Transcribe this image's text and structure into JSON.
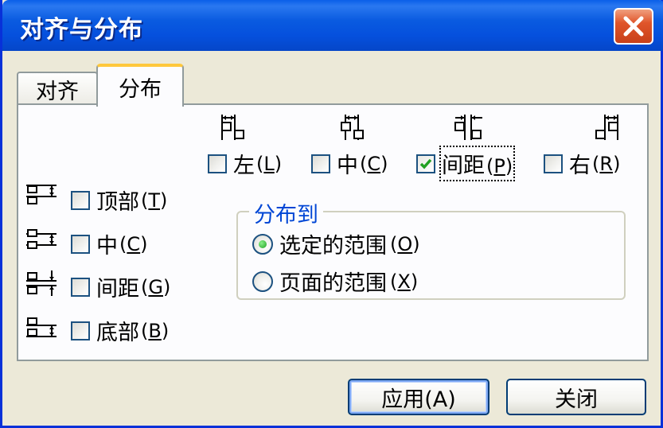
{
  "window": {
    "title": "对齐与分布"
  },
  "tabs": [
    {
      "label": "对齐",
      "active": false
    },
    {
      "label": "分布",
      "active": true
    }
  ],
  "horizontal": [
    {
      "label": "左",
      "key": "L",
      "checked": false,
      "icon": "distribute-left-icon"
    },
    {
      "label": "中",
      "key": "C",
      "checked": false,
      "icon": "distribute-center-horizontal-icon"
    },
    {
      "label": "间距",
      "key": "P",
      "checked": true,
      "icon": "distribute-horizontal-spacing-icon"
    },
    {
      "label": "右",
      "key": "R",
      "checked": false,
      "icon": "distribute-right-icon"
    }
  ],
  "vertical": [
    {
      "label": "顶部",
      "key": "T",
      "checked": false,
      "icon": "distribute-top-icon"
    },
    {
      "label": "中",
      "key": "C",
      "checked": false,
      "icon": "distribute-center-vertical-icon"
    },
    {
      "label": "间距",
      "key": "G",
      "checked": false,
      "icon": "distribute-vertical-spacing-icon"
    },
    {
      "label": "底部",
      "key": "B",
      "checked": false,
      "icon": "distribute-bottom-icon"
    }
  ],
  "distribute_to": {
    "title": "分布到",
    "options": [
      {
        "label": "选定的范围",
        "key": "O",
        "selected": true
      },
      {
        "label": "页面的范围",
        "key": "X",
        "selected": false
      }
    ]
  },
  "buttons": {
    "apply": "应用(A)",
    "close": "关闭"
  },
  "colors": {
    "titlebar": "#0550DD",
    "face": "#ECE9D8",
    "panel": "#FCFCFE",
    "accent_tab": "#FFC83C",
    "group_title": "#0046D5",
    "checkmark": "#21A121",
    "close_button": "#E0552A"
  }
}
